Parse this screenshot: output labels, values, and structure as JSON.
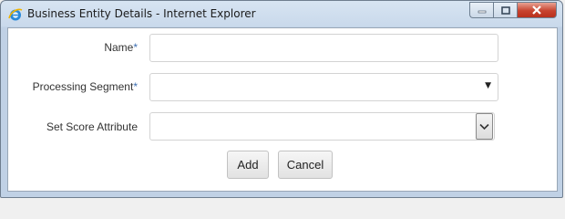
{
  "window": {
    "title": "Business Entity Details - Internet Explorer"
  },
  "form": {
    "name_label": "Name",
    "processing_segment_label": "Processing Segment",
    "set_score_attribute_label": "Set Score Attribute",
    "required_marker": "*",
    "name_value": "",
    "processing_segment_value": "",
    "set_score_attribute_value": ""
  },
  "buttons": {
    "add": "Add",
    "cancel": "Cancel"
  },
  "colors": {
    "required_marker": "#3d6fb2",
    "close_button": "#c7432f"
  },
  "icons": [
    "internet-explorer-icon",
    "minimize-icon",
    "maximize-icon",
    "close-icon",
    "dropdown-caret-icon",
    "chevron-down-icon"
  ]
}
